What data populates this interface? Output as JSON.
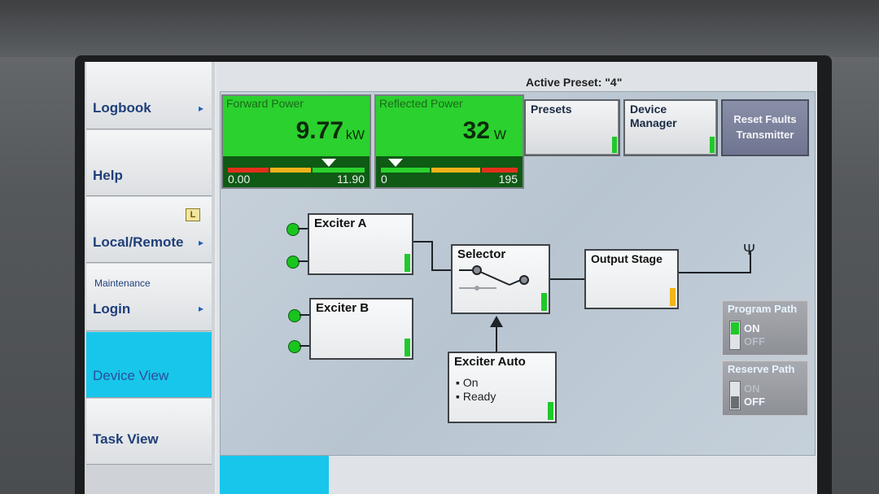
{
  "header": {
    "active_preset": "Active Preset: \"4\""
  },
  "sidebar": {
    "items": [
      {
        "label": "Logbook",
        "arrow": "▸"
      },
      {
        "label": "Help"
      },
      {
        "label": "Local/Remote",
        "arrow": "▸",
        "badge": "L"
      },
      {
        "label": "Login",
        "section": "Maintenance",
        "arrow": "▸"
      },
      {
        "label": "Device View",
        "active": true
      },
      {
        "label": "Task View"
      }
    ]
  },
  "meters": {
    "forward": {
      "title": "Forward Power",
      "value": "9.77",
      "unit": "kW",
      "min": "0.00",
      "max": "11.90",
      "pointer": 0.74
    },
    "reflected": {
      "title": "Reflected Power",
      "value": "32",
      "unit": "W",
      "min": "0",
      "max": "195",
      "pointer": 0.06
    }
  },
  "buttons": {
    "presets": "Presets",
    "device_manager_1": "Device",
    "device_manager_2": "Manager",
    "reset_1": "Reset Faults",
    "reset_2": "Transmitter"
  },
  "diagram": {
    "exciter_a": "Exciter A",
    "exciter_b": "Exciter B",
    "selector": "Selector",
    "output_stage": "Output Stage",
    "exciter_auto": {
      "title": "Exciter Auto",
      "line1": "On",
      "line2": "Ready"
    }
  },
  "paths": {
    "program": {
      "title": "Program Path",
      "on": "ON",
      "off": "OFF",
      "state": "ON"
    },
    "reserve": {
      "title": "Reserve Path",
      "on": "ON",
      "off": "OFF",
      "state": "OFF"
    }
  },
  "colors": {
    "accent": "#18c6ec",
    "meter_green": "#2bd12e",
    "status_ok": "#1fc92a",
    "status_warn": "#f2b51a"
  }
}
